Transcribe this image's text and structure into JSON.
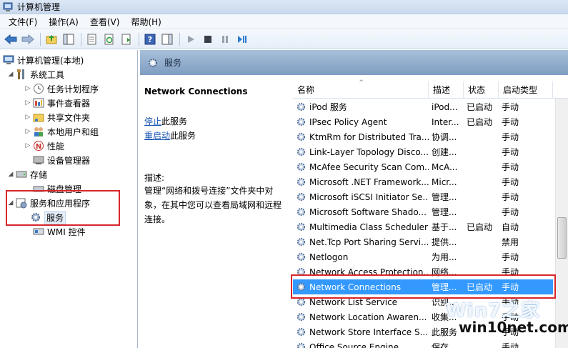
{
  "window": {
    "title": "计算机管理"
  },
  "menu": [
    "文件(F)",
    "操作(A)",
    "查看(V)",
    "帮助(H)"
  ],
  "toolbar": {
    "icons": [
      "back-icon",
      "forward-icon",
      "up-folder-icon",
      "show-hide-tree-icon",
      "export-list-icon",
      "refresh-icon",
      "properties-icon",
      "help-icon",
      "show-hide-action-icon",
      "start-service-icon",
      "stop-service-icon",
      "pause-service-icon",
      "restart-service-icon"
    ]
  },
  "tree": {
    "root": "计算机管理(本地)",
    "system_tools": "系统工具",
    "task_scheduler": "任务计划程序",
    "event_viewer": "事件查看器",
    "shared_folders": "共享文件夹",
    "local_users": "本地用户和组",
    "performance": "性能",
    "device_manager": "设备管理器",
    "storage": "存储",
    "disk_management": "磁盘管理",
    "services_apps": "服务和应用程序",
    "services": "服务",
    "wmi": "WMI 控件"
  },
  "pane": {
    "title": "服务"
  },
  "desc": {
    "service_name": "Network Connections",
    "stop_link": "停止",
    "stop_suffix": "此服务",
    "restart_link": "重启动",
    "restart_suffix": "此服务",
    "label": "描述:",
    "text": "管理“网络和拨号连接”文件夹中对象，在其中您可以查看局域网和远程连接。"
  },
  "columns": {
    "name": "名称",
    "desc": "描述",
    "status": "状态",
    "startup": "启动类型"
  },
  "services": [
    {
      "name": "iPod 服务",
      "desc": "iPod...",
      "status": "已启动",
      "startup": "手动"
    },
    {
      "name": "IPsec Policy Agent",
      "desc": "Inter...",
      "status": "已启动",
      "startup": "手动"
    },
    {
      "name": "KtmRm for Distributed Tra...",
      "desc": "协调...",
      "status": "",
      "startup": "手动"
    },
    {
      "name": "Link-Layer Topology Disco...",
      "desc": "创建...",
      "status": "",
      "startup": "手动"
    },
    {
      "name": "McAfee Security Scan Com...",
      "desc": "McA...",
      "status": "",
      "startup": "手动"
    },
    {
      "name": "Microsoft .NET Framework...",
      "desc": "Micr...",
      "status": "",
      "startup": "手动"
    },
    {
      "name": "Microsoft iSCSI Initiator Se...",
      "desc": "管理...",
      "status": "",
      "startup": "手动"
    },
    {
      "name": "Microsoft Software Shado...",
      "desc": "管理...",
      "status": "",
      "startup": "手动"
    },
    {
      "name": "Multimedia Class Scheduler",
      "desc": "基于...",
      "status": "已启动",
      "startup": "自动"
    },
    {
      "name": "Net.Tcp Port Sharing Servi...",
      "desc": "提供...",
      "status": "",
      "startup": "禁用"
    },
    {
      "name": "Netlogon",
      "desc": "为用...",
      "status": "",
      "startup": "手动"
    },
    {
      "name": "Network Access Protection...",
      "desc": "网络...",
      "status": "",
      "startup": "手动"
    },
    {
      "name": "Network Connections",
      "desc": "管理...",
      "status": "已启动",
      "startup": "手动"
    },
    {
      "name": "Network List Service",
      "desc": "识别...",
      "status": "",
      "startup": "手动"
    },
    {
      "name": "Network Location Awaren...",
      "desc": "收集...",
      "status": "",
      "startup": "手动"
    },
    {
      "name": "Network Store Interface S...",
      "desc": "此服务",
      "status": "",
      "startup": "手动"
    },
    {
      "name": "Office Source Engine",
      "desc": "保存...",
      "status": "",
      "startup": "手动"
    }
  ],
  "selected_row": "Network Connections",
  "watermark": {
    "top": "Win7之家",
    "bottom": "win10net.com"
  },
  "colors": {
    "selection": "#3399ff",
    "highlight_box": "#d8262b",
    "pane_header": "#8fa9c9"
  }
}
